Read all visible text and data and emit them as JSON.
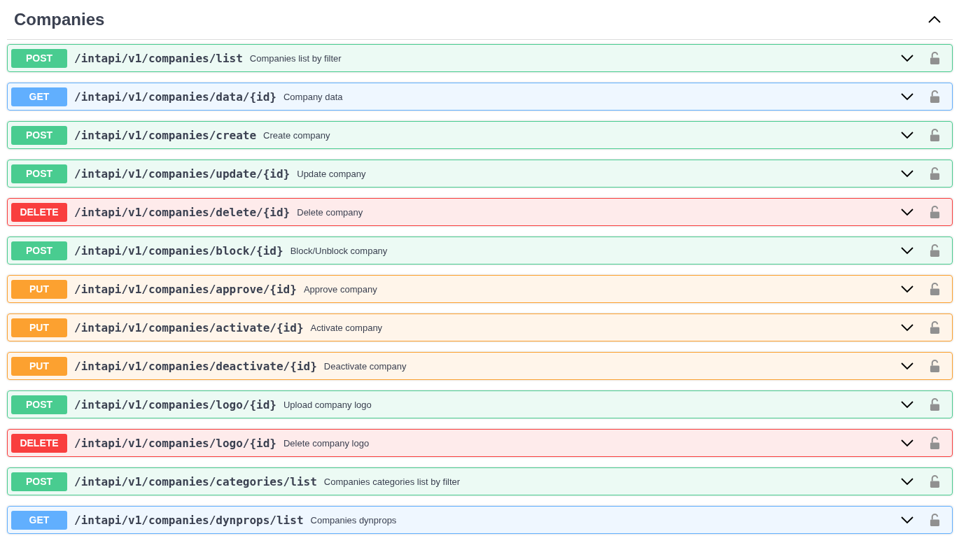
{
  "section": {
    "title": "Companies",
    "expanded": true
  },
  "operations": [
    {
      "kind": "post",
      "method": "POST",
      "path": "/intapi/v1/companies/list",
      "summary": "Companies list by filter",
      "expanded": false,
      "locked": false
    },
    {
      "kind": "get",
      "method": "GET",
      "path": "/intapi/v1/companies/data/{id}",
      "summary": "Company data",
      "expanded": false,
      "locked": false
    },
    {
      "kind": "post",
      "method": "POST",
      "path": "/intapi/v1/companies/create",
      "summary": "Create company",
      "expanded": false,
      "locked": false
    },
    {
      "kind": "post",
      "method": "POST",
      "path": "/intapi/v1/companies/update/{id}",
      "summary": "Update company",
      "expanded": false,
      "locked": false
    },
    {
      "kind": "delete",
      "method": "DELETE",
      "path": "/intapi/v1/companies/delete/{id}",
      "summary": "Delete company",
      "expanded": false,
      "locked": false
    },
    {
      "kind": "post",
      "method": "POST",
      "path": "/intapi/v1/companies/block/{id}",
      "summary": "Block/Unblock company",
      "expanded": false,
      "locked": false
    },
    {
      "kind": "put",
      "method": "PUT",
      "path": "/intapi/v1/companies/approve/{id}",
      "summary": "Approve company",
      "expanded": false,
      "locked": false
    },
    {
      "kind": "put",
      "method": "PUT",
      "path": "/intapi/v1/companies/activate/{id}",
      "summary": "Activate company",
      "expanded": false,
      "locked": false
    },
    {
      "kind": "put",
      "method": "PUT",
      "path": "/intapi/v1/companies/deactivate/{id}",
      "summary": "Deactivate company",
      "expanded": false,
      "locked": false
    },
    {
      "kind": "post",
      "method": "POST",
      "path": "/intapi/v1/companies/logo/{id}",
      "summary": "Upload company logo",
      "expanded": false,
      "locked": false
    },
    {
      "kind": "delete",
      "method": "DELETE",
      "path": "/intapi/v1/companies/logo/{id}",
      "summary": "Delete company logo",
      "expanded": false,
      "locked": false
    },
    {
      "kind": "post",
      "method": "POST",
      "path": "/intapi/v1/companies/categories/list",
      "summary": "Companies categories list by filter",
      "expanded": false,
      "locked": false
    },
    {
      "kind": "get",
      "method": "GET",
      "path": "/intapi/v1/companies/dynprops/list",
      "summary": "Companies dynprops",
      "expanded": false,
      "locked": false
    }
  ]
}
